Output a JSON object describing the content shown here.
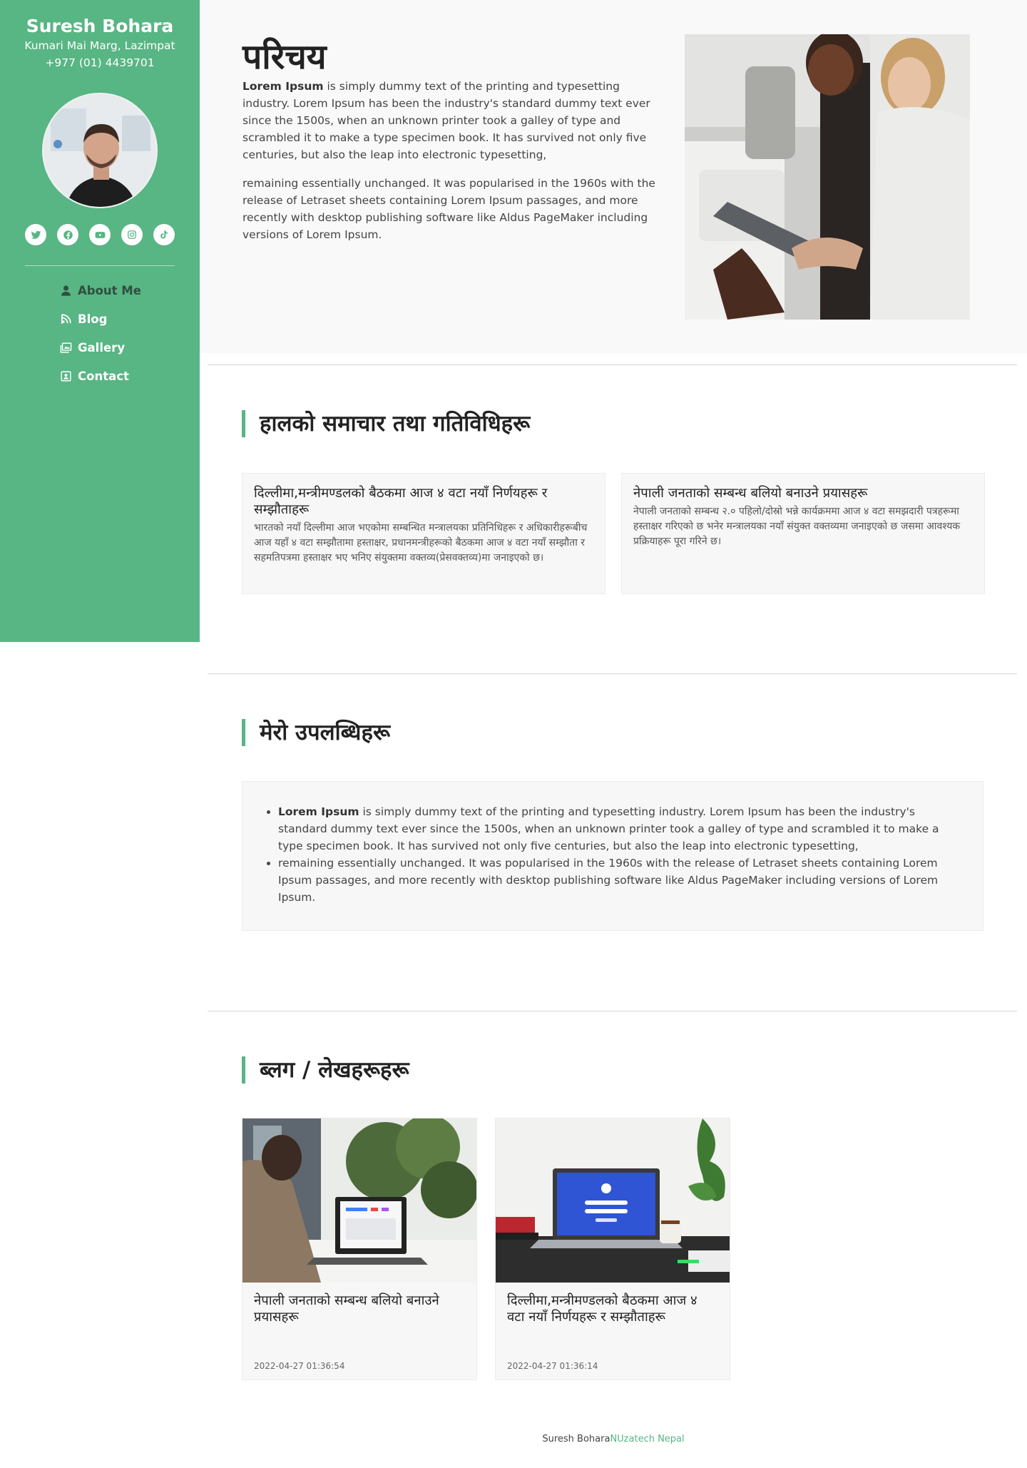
{
  "sidebar": {
    "name": "Suresh Bohara",
    "address": "Kumari Mai Marg, Lazimpat",
    "phone": "+977 (01) 4439701",
    "social": [
      {
        "icon": "twitter-icon"
      },
      {
        "icon": "facebook-icon"
      },
      {
        "icon": "youtube-icon"
      },
      {
        "icon": "instagram-icon"
      },
      {
        "icon": "tiktok-icon"
      }
    ],
    "nav": [
      {
        "label": "About Me",
        "icon": "user-icon",
        "active": true
      },
      {
        "label": "Blog",
        "icon": "blog-icon"
      },
      {
        "label": "Gallery",
        "icon": "gallery-icon"
      },
      {
        "label": "Contact",
        "icon": "contact-icon"
      }
    ]
  },
  "hero": {
    "title": "परिचय",
    "p1_bold": "Lorem Ipsum",
    "p1_rest": " is simply dummy text of the printing and typesetting industry. Lorem Ipsum has been the industry's standard dummy text ever since the 1500s, when an unknown printer took a galley of type and scrambled it to make a type specimen book. It has survived not only five centuries, but also the leap into electronic typesetting,",
    "p2": "remaining essentially unchanged. It was popularised in the 1960s with the release of Letraset sheets containing Lorem Ipsum passages, and more recently with desktop publishing software like Aldus PageMaker including versions of Lorem Ipsum."
  },
  "section1": {
    "title": "हालको समाचार तथा गतिविधिहरू",
    "cards": [
      {
        "title": "दिल्लीमा,मन्त्रीमण्डलको बैठकमा आज ४ वटा नयाँ निर्णयहरू र सम्झौताहरू",
        "text": "भारतको नयाँ दिल्लीमा आज भएकोमा सम्बन्धित मन्त्रालयका प्रतिनिधिहरू र अधिकारीहरूबीच आज यहाँ ४ वटा सम्झौतामा हस्ताक्षर, प्रधानमन्त्रीहरूको बैठकमा आज ४ वटा नयाँ सम्झौता र सहमतिपत्रमा हस्ताक्षर भए भनिए संयुक्तमा वक्तव्य(प्रेसवक्तव्य)मा जनाइएको छ।"
      },
      {
        "title": "नेपाली जनताको सम्बन्ध बलियो बनाउने प्रयासहरू",
        "text": "नेपाली जनताको सम्बन्ध २.० पहिलो/दोस्रो भन्ने कार्यक्रममा आज ४ वटा समझदारी पत्रहरूमा हस्ताक्षर गरिएको छ भनेर मन्त्रालयका नयाँ संयुक्त वक्तव्यमा जनाइएको छ जसमा आवश्यक प्रक्रियाहरू पूरा गरिने छ।"
      }
    ]
  },
  "section2": {
    "title": "मेरो उपलब्धिहरू",
    "items": [
      {
        "bold": "Lorem Ipsum",
        "rest": " is simply dummy text of the printing and typesetting industry. Lorem Ipsum has been the industry's standard dummy text ever since the 1500s, when an unknown printer took a galley of type and scrambled it to make a type specimen book. It has survived not only five centuries, but also the leap into electronic typesetting,"
      },
      {
        "bold": "",
        "rest": "remaining essentially unchanged. It was popularised in the 1960s with the release of Letraset sheets containing Lorem Ipsum passages, and more recently with desktop publishing software like Aldus PageMaker including versions of Lorem Ipsum."
      }
    ]
  },
  "section3": {
    "title": "ब्लग / लेखहरूहरू",
    "posts": [
      {
        "title": "नेपाली जनताको सम्बन्ध बलियो बनाउने प्रयासहरू",
        "date": "2022-04-27 01:36:54"
      },
      {
        "title": "दिल्लीमा,मन्त्रीमण्डलको बैठकमा आज ४ वटा नयाँ निर्णयहरू र सम्झौताहरू",
        "date": "2022-04-27 01:36:14"
      }
    ]
  },
  "footer": {
    "name": "Suresh Bohara",
    "link": "NUzatech Nepal"
  },
  "colors": {
    "accent": "#58b584",
    "hero_bg": "#f9f9f9"
  }
}
